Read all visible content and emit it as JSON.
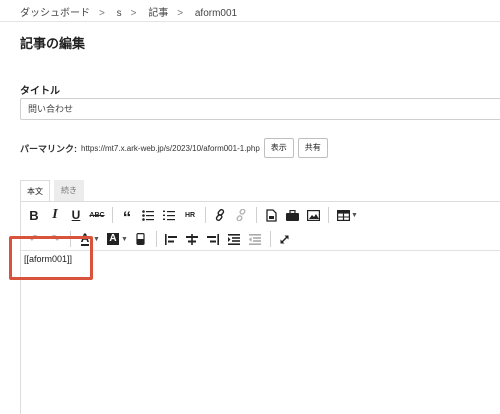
{
  "breadcrumb": [
    "ダッシュボード",
    "s",
    "記事",
    "aform001"
  ],
  "page_title": "記事の編集",
  "title_field": {
    "label": "タイトル",
    "value": "問い合わせ"
  },
  "permalink": {
    "label": "パーマリンク:",
    "url": "https://mt7.x.ark-web.jp/s/2023/10/aform001-1.php",
    "view_button": "表示",
    "share_button": "共有"
  },
  "tabs": [
    "本文",
    "続き"
  ],
  "toolbar": {
    "row1": [
      "bold-icon",
      "italic-icon",
      "underline-icon",
      "strikethrough-icon",
      "blockquote-icon",
      "bulleted-list-icon",
      "numbered-list-icon",
      "horizontal-rule-icon",
      "link-icon",
      "unlink-icon",
      "insert-file-icon",
      "insert-asset-icon",
      "insert-image-icon",
      "table-icon"
    ],
    "row2": [
      "undo-icon",
      "redo-icon",
      "text-color-icon",
      "background-color-icon",
      "clear-format-icon",
      "align-left-icon",
      "align-center-icon",
      "align-right-icon",
      "indent-icon",
      "outdent-icon",
      "fullscreen-icon"
    ],
    "labels": {
      "strikethrough": "ABC",
      "horizontal_rule": "HR"
    }
  },
  "editor_content": "[[aform001]]",
  "colors": {
    "highlight": "#d9533c",
    "border": "#dcdcdc"
  }
}
